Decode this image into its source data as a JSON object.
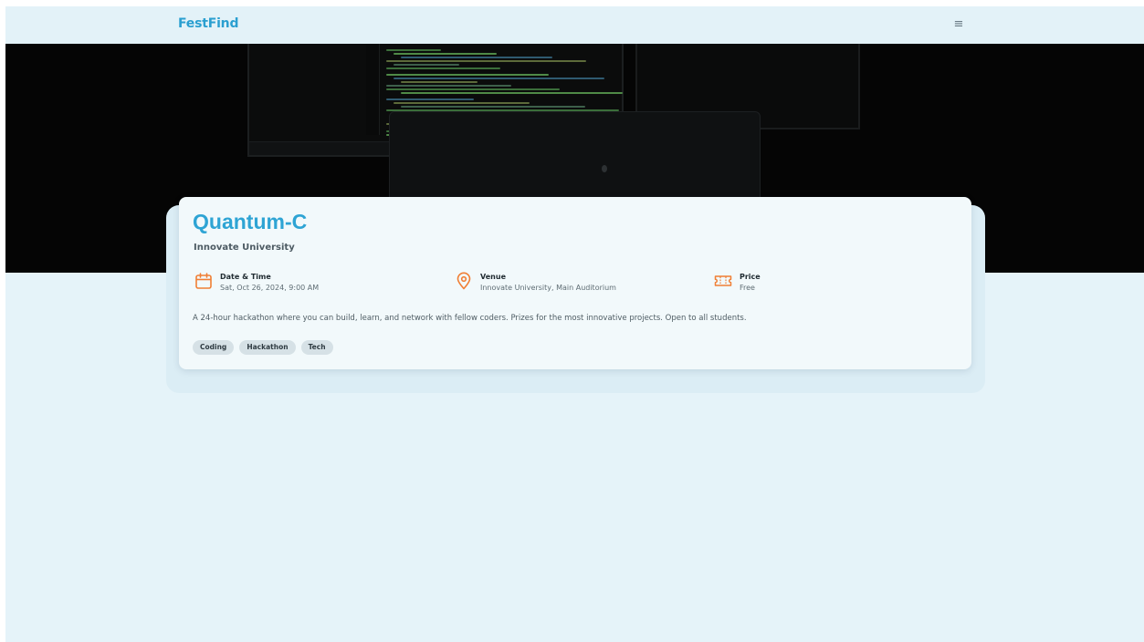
{
  "app": {
    "brand": "FestFind"
  },
  "nav": {
    "menu_icon": "hamburger-menu-icon",
    "menu_glyph": "≡"
  },
  "event": {
    "title": "Quantum-C",
    "organizer": "Innovate University",
    "details": {
      "date": {
        "icon": "calendar-icon",
        "label": "Date & Time",
        "value": "Sat, Oct 26, 2024, 9:00 AM"
      },
      "venue": {
        "icon": "location-pin-icon",
        "label": "Venue",
        "value": "Innovate University, Main Auditorium"
      },
      "price": {
        "icon": "ticket-icon",
        "label": "Price",
        "value": "Free"
      }
    },
    "description": "A 24-hour hackathon where you can build, learn, and network with fellow coders. Prizes for the most innovative projects. Open to all students.",
    "tags": [
      "Coding",
      "Hackathon",
      "Tech"
    ]
  },
  "colors": {
    "brand": "#2a9fd0",
    "title": "#2ea4d4",
    "icon_accent": "#f07f35",
    "page_background": "#e5f3f9",
    "card_background": "#f2f9fb",
    "tag_background": "#d6e1e6"
  }
}
